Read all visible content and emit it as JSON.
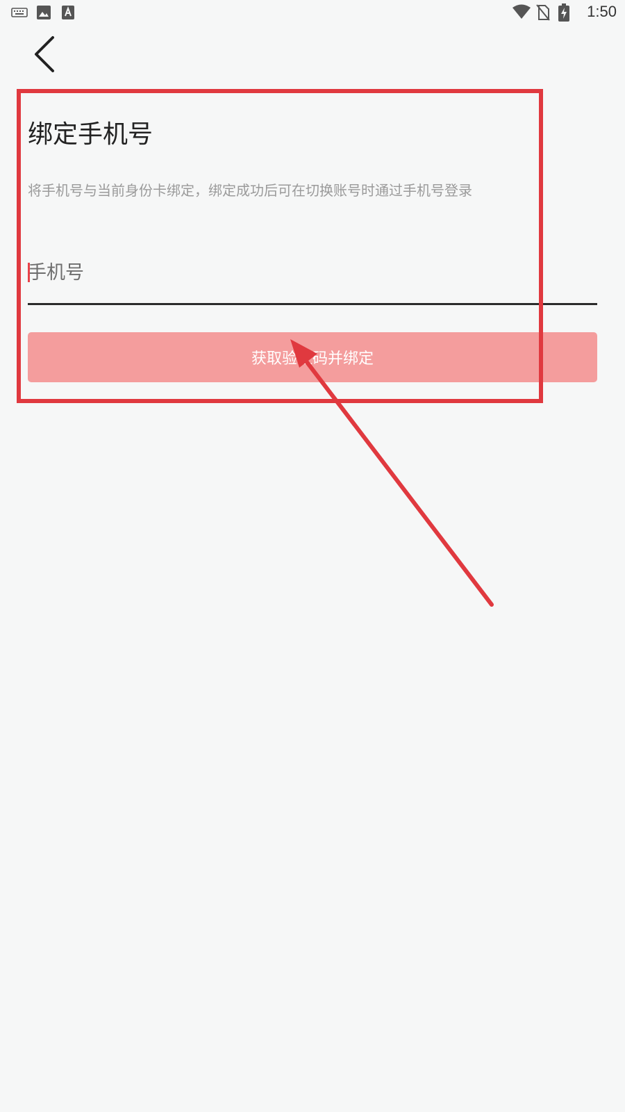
{
  "status_bar": {
    "time": "1:50",
    "icons": [
      "keyboard-icon",
      "image-icon",
      "font-icon",
      "wifi-icon",
      "no-sim-icon",
      "battery-charging-icon"
    ]
  },
  "nav": {
    "back_icon": "chevron-left-icon"
  },
  "content": {
    "title": "绑定手机号",
    "description": "将手机号与当前身份卡绑定，绑定成功后可在切换账号时通过手机号登录",
    "phone_placeholder": "手机号",
    "phone_value": "",
    "bind_button_label": "获取验证码并绑定"
  },
  "colors": {
    "background": "#f6f7f7",
    "button": "#f49d9d",
    "annotation": "#e0393f",
    "cursor": "#e8434a"
  }
}
